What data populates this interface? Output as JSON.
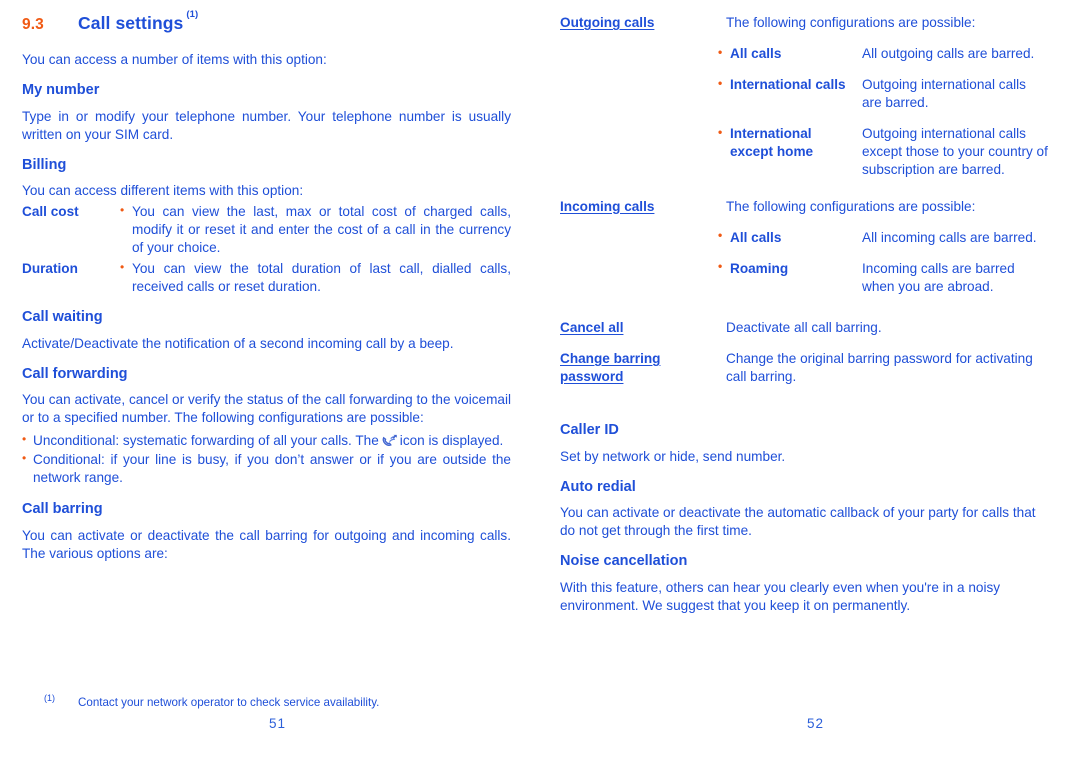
{
  "document": {
    "text_color": "#1f4fd8",
    "accent_color": "#f05a14"
  },
  "left_page": {
    "section": {
      "number": "9.3",
      "title": "Call settings",
      "footnote_marker": "(1)"
    },
    "intro": "You can access a number of items with this option:",
    "my_number": {
      "heading": "My number",
      "body": "Type in or modify your telephone number. Your telephone number is usually written on your SIM card."
    },
    "billing": {
      "heading": "Billing",
      "intro": "You can access different items with this option:",
      "items": [
        {
          "term": "Call cost",
          "desc": "You can view the last, max or total cost of charged calls, modify it or reset it and enter the cost of a call in the currency of your choice."
        },
        {
          "term": "Duration",
          "desc": "You can view the total duration of last call, dialled calls, received calls or reset duration."
        }
      ]
    },
    "call_waiting": {
      "heading": "Call waiting",
      "body": "Activate/Deactivate the notification of a second incoming call by a beep."
    },
    "call_forwarding": {
      "heading": "Call forwarding",
      "body": "You can activate, cancel or verify the status of the call forwarding to the voicemail or to a specified number. The following configurations are possible:",
      "bullets": [
        {
          "before": "Unconditional: systematic forwarding of all your calls. The",
          "icon": "call-forward-phone-icon",
          "after": "icon is displayed."
        },
        {
          "before": "Conditional: if your line is busy, if you don’t answer or if you are outside the network range.",
          "icon": null,
          "after": ""
        }
      ]
    },
    "call_barring": {
      "heading": "Call barring",
      "body": "You can activate or deactivate the call barring for outgoing and incoming calls. The various options are:"
    },
    "footnote": {
      "marker": "(1)",
      "text": "Contact your network operator to check service availability."
    },
    "folio": "51"
  },
  "right_page": {
    "groups": [
      {
        "term": "Outgoing calls",
        "desc": "The following configurations are possible:",
        "options": [
          {
            "label": "All calls",
            "desc": "All outgoing calls are barred."
          },
          {
            "label": "International calls",
            "desc": "Outgoing international calls are barred."
          },
          {
            "label": "International except home",
            "desc": "Outgoing international calls except those to your country of subscription are barred."
          }
        ]
      },
      {
        "term": "Incoming calls",
        "desc": "The following configurations are possible:",
        "options": [
          {
            "label": "All calls",
            "desc": "All incoming calls are barred."
          },
          {
            "label": "Roaming",
            "desc": "Incoming calls are barred when you are abroad."
          }
        ]
      }
    ],
    "cancel_all": {
      "term": "Cancel all",
      "desc": "Deactivate all call barring."
    },
    "change_password": {
      "term": "Change barring password",
      "desc": "Change the original barring password for activating call barring."
    },
    "caller_id": {
      "heading": "Caller ID",
      "body": "Set by network or hide, send number."
    },
    "auto_redial": {
      "heading": "Auto redial",
      "body": "You can activate or deactivate the automatic callback of your party for calls that do not get through the first time."
    },
    "noise_cancellation": {
      "heading": "Noise cancellation",
      "body": "With this feature, others can hear you clearly even when you're in a noisy environment. We suggest that you keep it on permanently."
    },
    "folio": "52"
  }
}
